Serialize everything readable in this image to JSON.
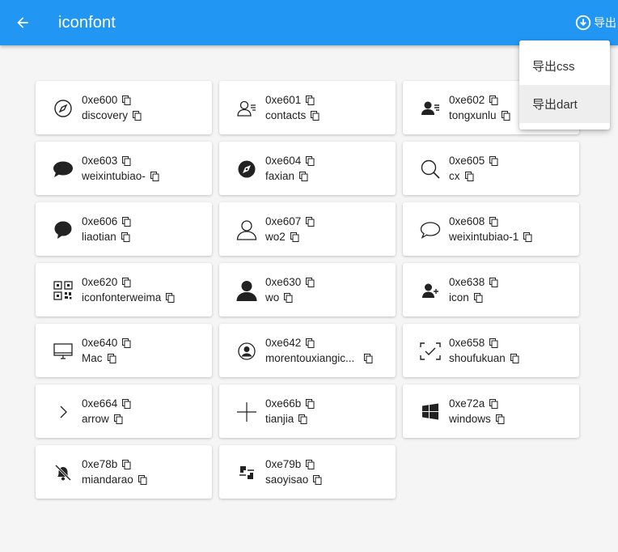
{
  "appbar": {
    "title": "iconfont",
    "export_label": "导出",
    "back_icon": "arrow-back-icon",
    "export_icon": "download-circle-icon",
    "background": "#2196f3"
  },
  "menu": {
    "items": [
      {
        "label": "导出css"
      },
      {
        "label": "导出dart"
      }
    ]
  },
  "icons": [
    {
      "code": "0xe600",
      "name": "discovery",
      "icon": "compass-outline-icon"
    },
    {
      "code": "0xe601",
      "name": "contacts",
      "icon": "contacts-outline-icon"
    },
    {
      "code": "0xe602",
      "name": "tongxunlu",
      "icon": "address-book-icon"
    },
    {
      "code": "0xe603",
      "name": "weixintubiao-",
      "icon": "chat-bubble-filled-icon"
    },
    {
      "code": "0xe604",
      "name": "faxian",
      "icon": "compass-filled-icon"
    },
    {
      "code": "0xe605",
      "name": "cx",
      "icon": "search-icon"
    },
    {
      "code": "0xe606",
      "name": "liaotian",
      "icon": "speech-bubble-filled-icon"
    },
    {
      "code": "0xe607",
      "name": "wo2",
      "icon": "user-outline-icon"
    },
    {
      "code": "0xe608",
      "name": "weixintubiao-1",
      "icon": "chat-bubble-outline-icon"
    },
    {
      "code": "0xe620",
      "name": "iconfonterweima",
      "icon": "qr-code-icon"
    },
    {
      "code": "0xe630",
      "name": "wo",
      "icon": "user-filled-icon"
    },
    {
      "code": "0xe638",
      "name": "icon",
      "icon": "add-user-icon"
    },
    {
      "code": "0xe640",
      "name": "Mac",
      "icon": "monitor-icon"
    },
    {
      "code": "0xe642",
      "name": "morentouxiangic...",
      "icon": "avatar-circle-icon"
    },
    {
      "code": "0xe658",
      "name": "shoufukuan",
      "icon": "scan-check-icon"
    },
    {
      "code": "0xe664",
      "name": "arrow",
      "icon": "chevron-right-icon"
    },
    {
      "code": "0xe66b",
      "name": "tianjia",
      "icon": "plus-icon"
    },
    {
      "code": "0xe72a",
      "name": "windows",
      "icon": "windows-logo-icon"
    },
    {
      "code": "0xe78b",
      "name": "miandarao",
      "icon": "bell-off-icon"
    },
    {
      "code": "0xe79b",
      "name": "saoyisao",
      "icon": "scan-icon"
    }
  ]
}
